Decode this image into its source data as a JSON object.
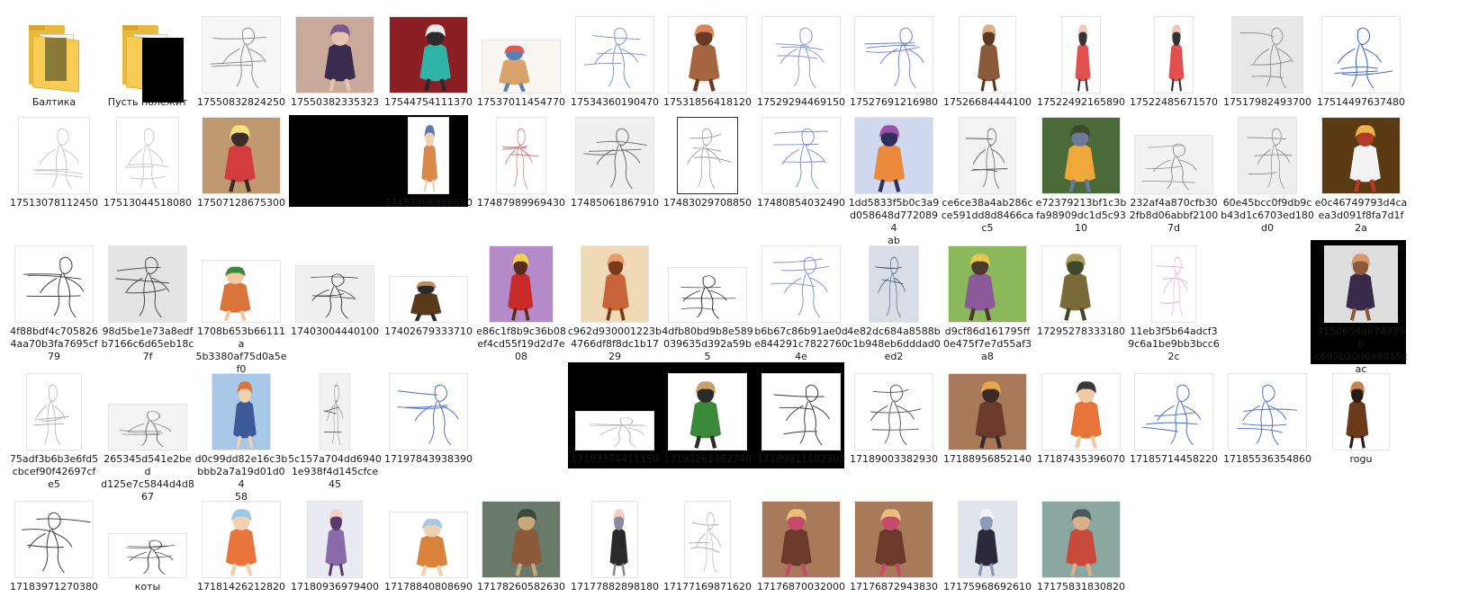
{
  "items": [
    {
      "name": "Балтика",
      "kind": "folder",
      "content": "#8a7a3a"
    },
    {
      "name": "Пусть полежит",
      "kind": "folder",
      "redacted": true
    },
    {
      "name": "17550832824250",
      "w": 88,
      "h": 86,
      "bg": "#f7f7f7",
      "style": "sketch",
      "ink": "#888888"
    },
    {
      "name": "17550382335323",
      "w": 88,
      "h": 86,
      "bg": "#c9a99a",
      "style": "paint",
      "colors": [
        "#3b2b4f",
        "#7a5a8c",
        "#e6c3b0"
      ]
    },
    {
      "name": "17544754111370",
      "w": 88,
      "h": 86,
      "bg": "#8c1f24",
      "style": "paint",
      "colors": [
        "#2fb5a8",
        "#e9e9e9",
        "#2a2a2a"
      ]
    },
    {
      "name": "17537011454770",
      "w": 88,
      "h": 60,
      "bg": "#faf7f2",
      "style": "paint",
      "colors": [
        "#d8a36a",
        "#e9544b",
        "#5a7fb4"
      ]
    },
    {
      "name": "17534360190470",
      "w": 88,
      "h": 86,
      "bg": "#ffffff",
      "style": "sketch",
      "ink": "#7f8fd0"
    },
    {
      "name": "17531856418120",
      "w": 88,
      "h": 86,
      "bg": "#ffffff",
      "style": "paint",
      "colors": [
        "#a5653e",
        "#d9845a",
        "#6b3a24"
      ]
    },
    {
      "name": "17529294469150",
      "w": 88,
      "h": 86,
      "bg": "#ffffff",
      "style": "sketch",
      "ink": "#8b95d6"
    },
    {
      "name": "17527691216980",
      "w": 88,
      "h": 86,
      "bg": "#ffffff",
      "style": "sketch",
      "ink": "#6c7fd8"
    },
    {
      "name": "17526684444100",
      "w": 64,
      "h": 86,
      "bg": "#ffffff",
      "style": "paint",
      "colors": [
        "#8a5a3a",
        "#d9b089",
        "#5a3a22"
      ]
    },
    {
      "name": "17522492165890",
      "w": 44,
      "h": 86,
      "bg": "#ffffff",
      "style": "paint",
      "colors": [
        "#e0504f",
        "#f3c9b5",
        "#333333"
      ]
    },
    {
      "name": "17522485671570",
      "w": 44,
      "h": 86,
      "bg": "#ffffff",
      "style": "paint",
      "colors": [
        "#e0504f",
        "#f3c9b5",
        "#333333"
      ]
    },
    {
      "name": "17517982493700",
      "w": 80,
      "h": 86,
      "bg": "#e8e8e8",
      "style": "sketch",
      "ink": "#8a8a8a"
    },
    {
      "name": "17514497637480",
      "w": 88,
      "h": 86,
      "bg": "#ffffff",
      "style": "sketch",
      "ink": "#2f5ab8"
    },
    {
      "name": "17513078112450",
      "w": 80,
      "h": 86,
      "bg": "#ffffff",
      "style": "sketch",
      "ink": "#c2c2c2"
    },
    {
      "name": "17513044518080",
      "w": 70,
      "h": 86,
      "bg": "#ffffff",
      "style": "sketch",
      "ink": "#c2c2c2"
    },
    {
      "name": "17507128675300",
      "w": 88,
      "h": 86,
      "bg": "#bf9a70",
      "style": "paint",
      "colors": [
        "#d43d3d",
        "#f3e27a",
        "#3b2b2b"
      ]
    },
    {
      "name": "",
      "kind": "redacted"
    },
    {
      "name": "17487966886890",
      "w": 46,
      "h": 86,
      "bg": "#ffffff",
      "style": "paint",
      "colors": [
        "#d98a4a",
        "#5a78b4",
        "#f2d0b0"
      ]
    },
    {
      "name": "17487989969430",
      "w": 56,
      "h": 86,
      "bg": "#ffffff",
      "style": "sketch",
      "ink": "#d06060"
    },
    {
      "name": "17485061867910",
      "w": 88,
      "h": 86,
      "bg": "#f0f0f0",
      "style": "sketch",
      "ink": "#666666"
    },
    {
      "name": "17483029708850",
      "w": 68,
      "h": 86,
      "bg": "#ffffff",
      "style": "sketch",
      "ink": "#9a9a9a",
      "frame": true
    },
    {
      "name": "17480854032490",
      "w": 88,
      "h": 86,
      "bg": "#ffffff",
      "style": "sketch",
      "ink": "#7f8fd0"
    },
    {
      "name": "1dd5833f5b0c3a9d058648d7720894ab",
      "w": 88,
      "h": 86,
      "bg": "#cfd8ee",
      "style": "paint",
      "colors": [
        "#e98a3c",
        "#9a4fa6",
        "#2f2f5a"
      ]
    },
    {
      "name": "ce6ce38a4ab286cce591dd8d8466cac5",
      "w": 64,
      "h": 86,
      "bg": "#f3f3f3",
      "style": "sketch",
      "ink": "#555555"
    },
    {
      "name": "e72379213bf1c3bfa98909dc1d5c9310",
      "w": 88,
      "h": 86,
      "bg": "#4a6a3a",
      "style": "paint",
      "colors": [
        "#f0a83a",
        "#3a4a2a",
        "#6a7a9a"
      ]
    },
    {
      "name": "232af4a870cfb302fb8d06abbf21007d",
      "w": 88,
      "h": 66,
      "bg": "#f2f2f2",
      "style": "sketch",
      "ink": "#8a8a8a"
    },
    {
      "name": "60e45bcc0f9db9cb43d1c6703ed180d0",
      "w": 66,
      "h": 86,
      "bg": "#eeeeee",
      "style": "sketch",
      "ink": "#8a8a8a"
    },
    {
      "name": "e0c46749793d4caea3d091f8fa7d1f2a",
      "w": 88,
      "h": 86,
      "bg": "#5a3a12",
      "style": "paint",
      "colors": [
        "#f2f2f2",
        "#e8b54a",
        "#b43a2a"
      ]
    },
    {
      "name": "4f88bdf4c7058264aa70b3fa7695cf79",
      "w": 88,
      "h": 86,
      "bg": "#ffffff",
      "style": "sketch",
      "ink": "#333333"
    },
    {
      "name": "98d5be1e73a8edfb7166c6d65eb18c7f",
      "w": 88,
      "h": 86,
      "bg": "#e4e4e4",
      "style": "sketch",
      "ink": "#444444"
    },
    {
      "name": "1708b653b66111a5b3380af75d0a5ef0",
      "w": 88,
      "h": 70,
      "bg": "#ffffff",
      "style": "paint",
      "colors": [
        "#d9743a",
        "#3a8a3a",
        "#f2c9a5"
      ]
    },
    {
      "name": "17403004440100",
      "w": 88,
      "h": 64,
      "bg": "#f0f0f0",
      "style": "sketch",
      "ink": "#333333"
    },
    {
      "name": "17402679333710",
      "w": 88,
      "h": 52,
      "bg": "#ffffff",
      "style": "paint",
      "colors": [
        "#5a3a1a",
        "#c48a5a",
        "#2a2a2a"
      ]
    },
    {
      "name": "e86c1f8b9c36b08ef4cd55f19d2d7e08",
      "w": 72,
      "h": 86,
      "bg": "#b48ac8",
      "style": "paint",
      "colors": [
        "#c82a2a",
        "#f2d24a",
        "#5a2a1a"
      ]
    },
    {
      "name": "c962d930001223b4766df8f8dc1b1729",
      "w": 76,
      "h": 86,
      "bg": "#f0d9b5",
      "style": "paint",
      "colors": [
        "#c8643a",
        "#e89a6a",
        "#7a3a1a"
      ]
    },
    {
      "name": "4dfb80bd9b8e589039635d392a59b597",
      "w": 88,
      "h": 62,
      "bg": "#ffffff",
      "style": "sketch",
      "ink": "#222222"
    },
    {
      "name": "b6b67c86b91ae0de844291c78227604e",
      "w": 88,
      "h": 86,
      "bg": "#ffffff",
      "style": "sketch",
      "ink": "#7f8fd0"
    },
    {
      "name": "4e82dc684a8588bc1b948eb6dddad0ed2",
      "w": 56,
      "h": 86,
      "bg": "#d8dde6",
      "style": "sketch",
      "ink": "#4a5a7a"
    },
    {
      "name": "d9cf86d161795ff0e475f7e7d55af3a8",
      "w": 88,
      "h": 86,
      "bg": "#8ab85a",
      "style": "paint",
      "colors": [
        "#8a5a9a",
        "#e8c84a",
        "#4a3a2a"
      ]
    },
    {
      "name": "17295278333180",
      "w": 88,
      "h": 86,
      "bg": "#ffffff",
      "style": "paint",
      "colors": [
        "#7a6a3a",
        "#a89a5a",
        "#3a4a2a"
      ]
    },
    {
      "name": "11eb3f5b64adcf39c6a1be9bb3bcc62c",
      "w": 50,
      "h": 86,
      "bg": "#ffffff",
      "style": "sketch",
      "ink": "#e0a8c8"
    },
    {
      "name": "",
      "kind": "redacted-small"
    },
    {
      "name": "4150654a674335bc695b20d6e8055cac",
      "w": 82,
      "h": 86,
      "bg": "#dedede",
      "style": "paint",
      "colors": [
        "#3a2a4a",
        "#d89a6a",
        "#8a5a3a"
      ]
    },
    {
      "name": "75adf3b6b3e6fd5cbcef90f42697cfe5",
      "w": 62,
      "h": 86,
      "bg": "#ffffff",
      "style": "sketch",
      "ink": "#aaaaaa"
    },
    {
      "name": "265345d541e2bedd125e7c5844d4d867",
      "w": 88,
      "h": 52,
      "bg": "#f4f4f4",
      "style": "sketch",
      "ink": "#666666"
    },
    {
      "name": "d0c99dd82e16c3bbbb2a7a19d01d0458",
      "w": 66,
      "h": 86,
      "bg": "#a8c8e8",
      "style": "paint",
      "colors": [
        "#3a5a9a",
        "#d9743a",
        "#f2d0b0"
      ]
    },
    {
      "name": "5c157a704dd69401e938f4d145cfce45",
      "w": 34,
      "h": 86,
      "bg": "#f2f2f2",
      "style": "sketch",
      "ink": "#666666"
    },
    {
      "name": "17197843938390",
      "w": 88,
      "h": 86,
      "bg": "#ffffff",
      "style": "sketch",
      "ink": "#4a6ac8"
    },
    {
      "name": "",
      "kind": "redacted-wide"
    },
    {
      "name": "17193374411150",
      "w": 88,
      "h": 44,
      "bg": "#ffffff",
      "style": "sketch",
      "ink": "#aaaaaa"
    },
    {
      "name": "17193261482740",
      "w": 88,
      "h": 86,
      "bg": "#ffffff",
      "style": "paint",
      "colors": [
        "#3a8a3a",
        "#c8a06a",
        "#2a2a2a"
      ]
    },
    {
      "name": "17189811102300",
      "w": 88,
      "h": 86,
      "bg": "#ffffff",
      "style": "sketch",
      "ink": "#333333"
    },
    {
      "name": "17189003382930",
      "w": 88,
      "h": 86,
      "bg": "#ffffff",
      "style": "sketch",
      "ink": "#555555"
    },
    {
      "name": "17188956852140",
      "w": 88,
      "h": 86,
      "bg": "#a87a5a",
      "style": "paint",
      "colors": [
        "#6a3a2a",
        "#e8a84a",
        "#3a2a2a"
      ]
    },
    {
      "name": "17187435396070",
      "w": 88,
      "h": 86,
      "bg": "#ffffff",
      "style": "paint",
      "colors": [
        "#e8743a",
        "#3a3a3a",
        "#f2c9a5"
      ]
    },
    {
      "name": "17185714458220",
      "w": 88,
      "h": 86,
      "bg": "#ffffff",
      "style": "sketch",
      "ink": "#4a6ac8"
    },
    {
      "name": "17185536354860",
      "w": 88,
      "h": 86,
      "bg": "#ffffff",
      "style": "sketch",
      "ink": "#4a6ac8"
    },
    {
      "name": "rogu",
      "w": 64,
      "h": 86,
      "bg": "#ffffff",
      "style": "paint",
      "colors": [
        "#6a3a1a",
        "#c8844a",
        "#2a1a1a"
      ]
    },
    {
      "name": "17183971270380",
      "w": 88,
      "h": 86,
      "bg": "#ffffff",
      "style": "sketch",
      "ink": "#333333"
    },
    {
      "name": "коты",
      "w": 88,
      "h": 50,
      "bg": "#ffffff",
      "style": "sketch",
      "ink": "#222222"
    },
    {
      "name": "17181426212820",
      "w": 88,
      "h": 86,
      "bg": "#ffffff",
      "style": "paint",
      "colors": [
        "#e8743a",
        "#9ac8e8",
        "#f2d0b0"
      ]
    },
    {
      "name": "17180936979400",
      "w": 62,
      "h": 86,
      "bg": "#eaeaf2",
      "style": "paint",
      "colors": [
        "#8a6aa8",
        "#f2d0c8",
        "#5a3a6a"
      ]
    },
    {
      "name": "17178840808690",
      "w": 88,
      "h": 74,
      "bg": "#ffffff",
      "style": "paint",
      "colors": [
        "#d9843a",
        "#a8c8e8",
        "#f0d0b0"
      ]
    },
    {
      "name": "17178260582630",
      "w": 88,
      "h": 86,
      "bg": "#6a7a6a",
      "style": "paint",
      "colors": [
        "#8a5a3a",
        "#3a4a3a",
        "#c8a87a"
      ]
    },
    {
      "name": "17177882898180",
      "w": 52,
      "h": 86,
      "bg": "#ffffff",
      "style": "paint",
      "colors": [
        "#2a2a2a",
        "#f2d0c8",
        "#8a8a9a"
      ]
    },
    {
      "name": "17177169871620",
      "w": 52,
      "h": 86,
      "bg": "#ffffff",
      "style": "sketch",
      "ink": "#aaaaaa"
    },
    {
      "name": "17176870032000",
      "w": 88,
      "h": 86,
      "bg": "#a87a5a",
      "style": "paint",
      "colors": [
        "#6a3a2a",
        "#e8c07a",
        "#c84a6a"
      ]
    },
    {
      "name": "17176872943830",
      "w": 88,
      "h": 86,
      "bg": "#a87a5a",
      "style": "paint",
      "colors": [
        "#6a3a2a",
        "#e8c07a",
        "#c84a6a"
      ]
    },
    {
      "name": "17175968692610",
      "w": 66,
      "h": 86,
      "bg": "#e0e4ec",
      "style": "paint",
      "colors": [
        "#2a2a3a",
        "#f2f2f2",
        "#8a9ab8"
      ]
    },
    {
      "name": "17175831830820",
      "w": 88,
      "h": 86,
      "bg": "#8aa8a0",
      "style": "paint",
      "colors": [
        "#c84a3a",
        "#4a5a5a",
        "#d8b08a"
      ]
    }
  ]
}
